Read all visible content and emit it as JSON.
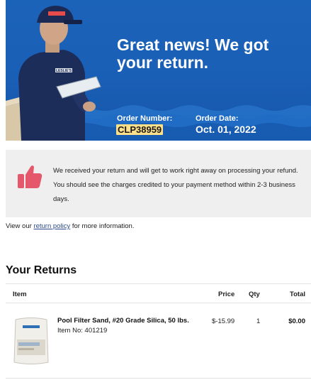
{
  "hero": {
    "title": "Great news! We got your return.",
    "brand_text": "LESLIE'S",
    "order_number_label": "Order Number:",
    "order_number": "CLP38959",
    "order_date_label": "Order Date:",
    "order_date": "Oct. 01, 2022",
    "colors": {
      "background": "#1a5fb6",
      "highlight": "#ffe08a"
    }
  },
  "notice": {
    "icon": "thumbs-up-icon",
    "icon_color": "#e5576b",
    "text": "We received your return and will get to work right away on processing your refund. You should see the charges credited to your payment method within 2-3 business days."
  },
  "policy": {
    "prefix": "View our ",
    "link": "return policy",
    "suffix": " for more information."
  },
  "returns": {
    "title": "Your Returns",
    "columns": {
      "item": "Item",
      "price": "Price",
      "qty": "Qty",
      "total": "Total"
    },
    "items": [
      {
        "name": "Pool Filter Sand, #20 Grade Silica, 50 lbs.",
        "item_no": "Item No: 401219",
        "price": "$-15.99",
        "qty": "1",
        "total": "$0.00",
        "image": "sand-bag-image"
      }
    ]
  }
}
